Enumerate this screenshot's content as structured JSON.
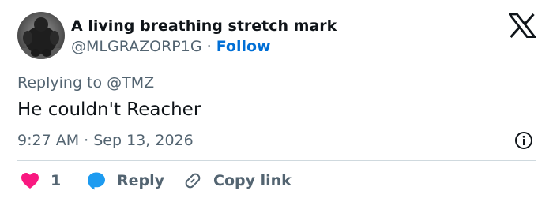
{
  "tweet": {
    "author": {
      "display_name": "A living breathing stretch mark",
      "handle": "@MLGRAZORP1G",
      "follow_label": "Follow"
    },
    "separator": "·",
    "reply_to": "Replying to @TMZ",
    "text": "He couldn't Reacher",
    "time": "9:27 AM",
    "date": "Sep 13, 2026",
    "likes": "1",
    "reply_label": "Reply",
    "copy_link_label": "Copy link"
  },
  "icons": {
    "brand": "x-logo-icon",
    "info": "info-icon",
    "like": "heart-icon",
    "reply": "speech-bubble-icon",
    "copy": "link-icon"
  },
  "colors": {
    "text_primary": "#0f1419",
    "text_secondary": "#536471",
    "follow": "#006fd6",
    "heart": "#f91880",
    "reply_bubble": "#1d9bf0",
    "divider": "#cfd9de"
  }
}
